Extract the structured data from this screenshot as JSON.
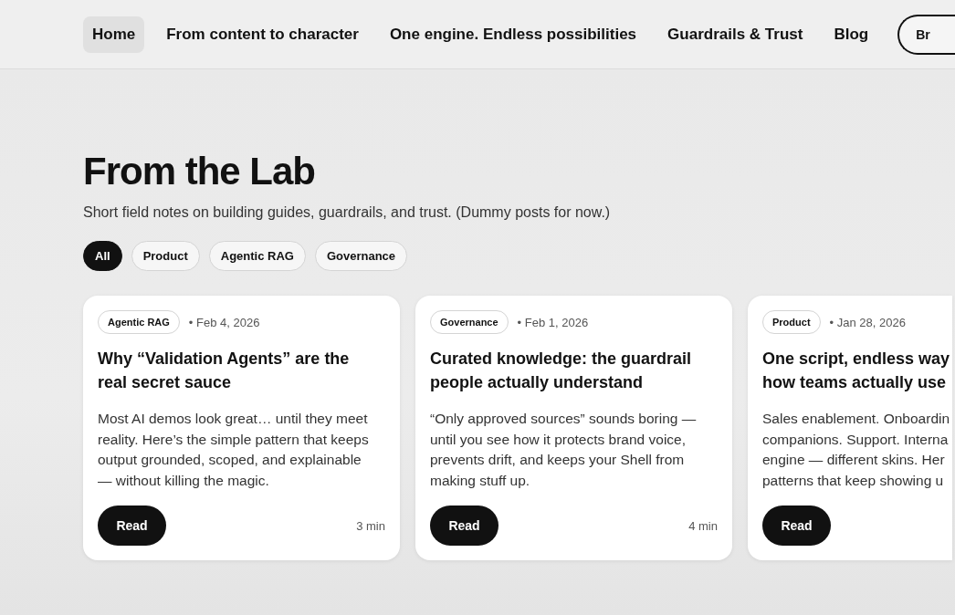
{
  "nav": {
    "items": [
      {
        "label": "Home",
        "selected": true
      },
      {
        "label": "From content to character",
        "selected": false
      },
      {
        "label": "One engine. Endless possibilities",
        "selected": false
      },
      {
        "label": "Guardrails & Trust",
        "selected": false
      },
      {
        "label": "Blog",
        "selected": false
      }
    ],
    "cta": "Br"
  },
  "heading": "From the Lab",
  "subtitle": "Short field notes on building guides, guardrails, and trust. (Dummy posts for now.)",
  "filters": [
    {
      "label": "All",
      "selected": true
    },
    {
      "label": "Product",
      "selected": false
    },
    {
      "label": "Agentic RAG",
      "selected": false
    },
    {
      "label": "Governance",
      "selected": false
    }
  ],
  "posts": [
    {
      "tag": "Agentic RAG",
      "date": "• Feb 4, 2026",
      "title": [
        "Why “Validation Agents” are the",
        "real secret sauce"
      ],
      "body": [
        "Most AI demos look great… until they meet",
        "reality. Here’s the simple pattern that keeps",
        "output grounded, scoped, and explainable",
        "— without killing the magic."
      ],
      "button": "Read",
      "read_time": "3 min"
    },
    {
      "tag": "Governance",
      "date": "• Feb 1, 2026",
      "title": [
        "Curated knowledge: the guardrail",
        "people actually understand"
      ],
      "body": [
        "“Only approved sources” sounds boring —",
        "until you see how it protects brand voice,",
        "prevents drift, and keeps your Shell from",
        "making stuff up."
      ],
      "button": "Read",
      "read_time": "4 min"
    },
    {
      "tag": "Product",
      "date": "• Jan 28, 2026",
      "title": [
        "One script, endless way",
        "how teams actually use"
      ],
      "body": [
        "Sales enablement. Onboardin",
        "companions. Support. Interna",
        "engine — different skins. Her",
        "patterns that keep showing u"
      ],
      "button": "Read"
    }
  ]
}
